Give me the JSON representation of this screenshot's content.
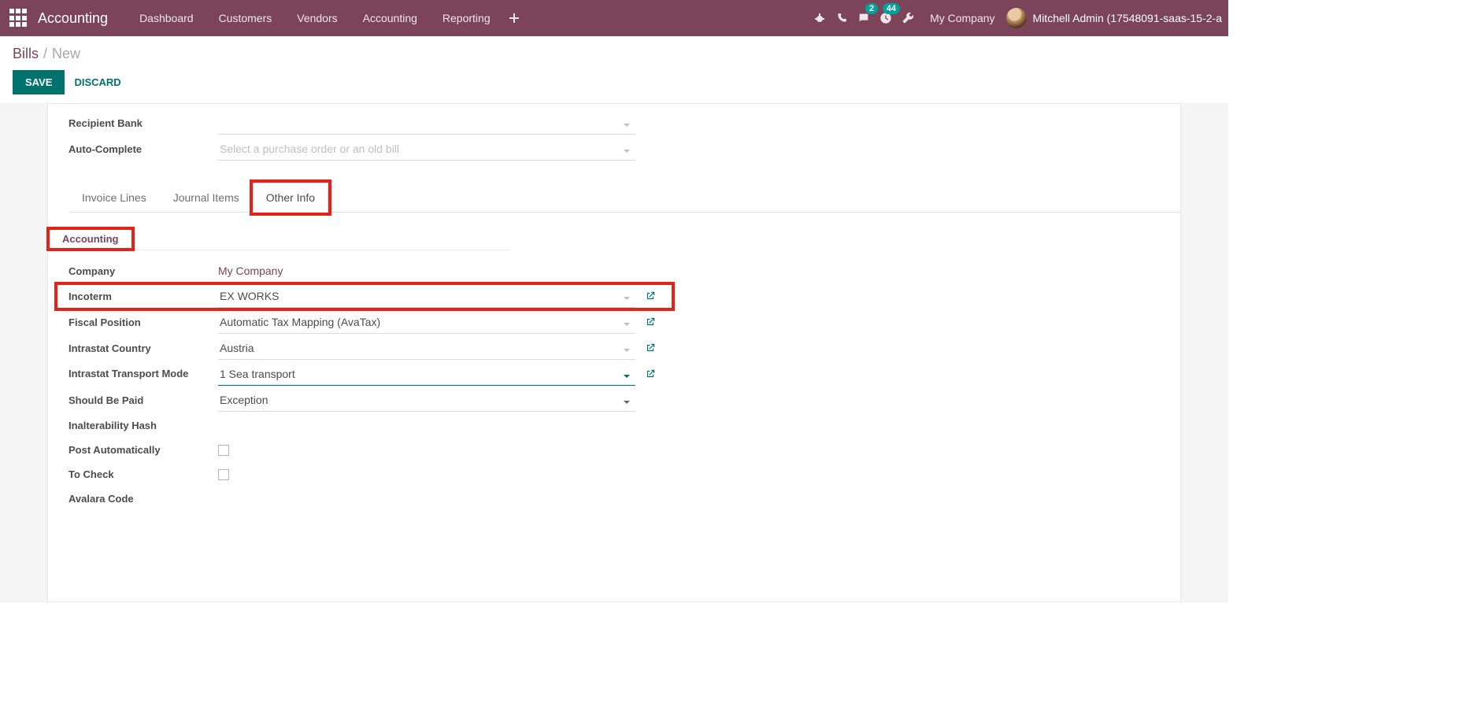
{
  "navbar": {
    "brand": "Accounting",
    "items": [
      "Dashboard",
      "Customers",
      "Vendors",
      "Accounting",
      "Reporting"
    ],
    "messages_badge": "2",
    "activities_badge": "44",
    "company": "My Company",
    "user": "Mitchell Admin (17548091-saas-15-2-a"
  },
  "breadcrumb": {
    "root": "Bills",
    "sep": "/",
    "current": "New"
  },
  "buttons": {
    "save": "SAVE",
    "discard": "DISCARD"
  },
  "top_fields": {
    "recipient_bank_label": "Recipient Bank",
    "recipient_bank_value": "",
    "auto_complete_label": "Auto-Complete",
    "auto_complete_placeholder": "Select a purchase order or an old bill"
  },
  "tabs": {
    "invoice_lines": "Invoice Lines",
    "journal_items": "Journal Items",
    "other_info": "Other Info"
  },
  "section": {
    "accounting": "Accounting"
  },
  "fields": {
    "company_label": "Company",
    "company_value": "My Company",
    "incoterm_label": "Incoterm",
    "incoterm_value": "EX WORKS",
    "fiscal_label": "Fiscal Position",
    "fiscal_value": "Automatic Tax Mapping (AvaTax)",
    "intrastat_country_label": "Intrastat Country",
    "intrastat_country_value": "Austria",
    "transport_label": "Intrastat Transport Mode",
    "transport_value": "1 Sea transport",
    "should_be_paid_label": "Should Be Paid",
    "should_be_paid_value": "Exception",
    "hash_label": "Inalterability Hash",
    "post_auto_label": "Post Automatically",
    "to_check_label": "To Check",
    "avalara_label": "Avalara Code"
  }
}
